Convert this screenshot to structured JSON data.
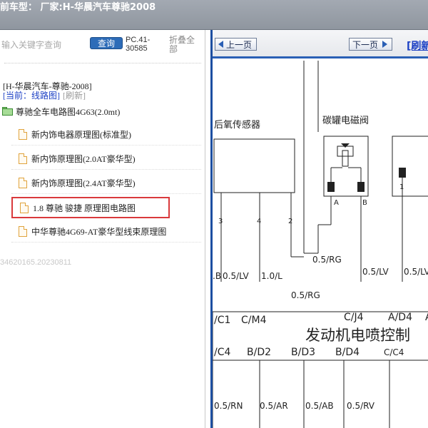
{
  "titlebar": {
    "text": "前车型：  厂家:H-华晨汽车尊驰2008"
  },
  "left": {
    "search_placeholder": "输入关键字查询",
    "query_button": "查询",
    "version": "PC.41-30585",
    "collapse": "折叠全部",
    "vehicle": "[H-华晨汽车-尊驰-2008]",
    "current_label": "[当前：线路图]",
    "refresh_label": "[刷新]",
    "root_folder": "尊驰全车电路图4G63(2.0mt)",
    "items": [
      {
        "label": "新内饰电器原理图(标准型)"
      },
      {
        "label": "新内饰原理图(2.0AT豪华型)"
      },
      {
        "label": "新内饰原理图(2.4AT豪华型)"
      },
      {
        "label": "1.8 尊驰 骏捷 原理图电路图"
      },
      {
        "label": "中华尊驰4G69-AT豪华型线束原理图"
      }
    ],
    "build": "34620165.20230811"
  },
  "viewer": {
    "prev_button": "上一页",
    "next_button": "下一页",
    "refresh": "[刷新"
  },
  "diagram": {
    "labels": {
      "o2_sensor": "后氧传感器",
      "canister_valve": "碳罐电磁阀",
      "pin3": "3",
      "pin4": "4",
      "pin2": "2",
      "pinA": "A",
      "pinB": "B",
      "pin1": "1",
      "w_b": ".B",
      "w_lv1": "0.5/LV",
      "w_l": "1.0/L",
      "w_rg1": "0.5/RG",
      "w_lv2": "0.5/LV",
      "w_lv3": "0.5/LV",
      "w_rg2": "0.5/RG",
      "c1": "/C1",
      "m4": "C/M4",
      "j4": "C/J4",
      "d4a": "A/D4",
      "a_partial": "A",
      "ecu": "发动机电喷控制",
      "c4a": "/C4",
      "d2": "B/D2",
      "d3": "B/D3",
      "d4b": "B/D4",
      "c4b": "C/C4",
      "w_rn": "0.5/RN",
      "w_ar": "0.5/AR",
      "w_ab": "0.5/AB",
      "w_rv": "0.5/RV"
    }
  }
}
